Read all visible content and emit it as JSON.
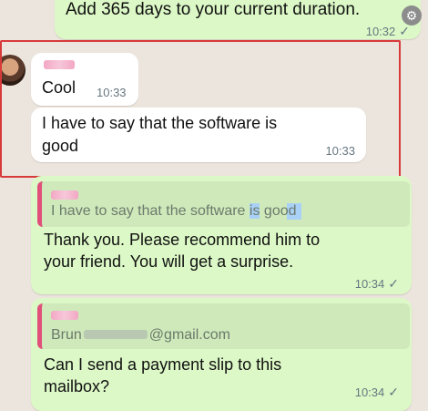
{
  "messages": {
    "top": {
      "text": "Add 365 days to your current duration.",
      "time": "10:32"
    },
    "cool": {
      "text": "Cool",
      "time": "10:33"
    },
    "software": {
      "text_line1": "I have to say that the software is",
      "text_line2": "good",
      "time": "10:33"
    },
    "reply_thankyou": {
      "quote_text_before": "I have to say that the software ",
      "quote_text_highlight": "is",
      "quote_text_after": " good",
      "line1": "Thank you. Please recommend him to",
      "line2": "your friend. You will get a surprise.",
      "time": "10:34"
    },
    "payment": {
      "quote_email_prefix": "Brun",
      "quote_email_suffix": "@gmail.com",
      "line1": "Can I send a payment slip to this",
      "line2": "mailbox?",
      "time": "10:34"
    }
  },
  "icons": {
    "check": "✓",
    "menu": "⚙"
  },
  "colors": {
    "accent": "#e0507a",
    "outgoing": "#dcf8c6",
    "incoming": "#ffffff",
    "selection": "#d83a3a"
  }
}
